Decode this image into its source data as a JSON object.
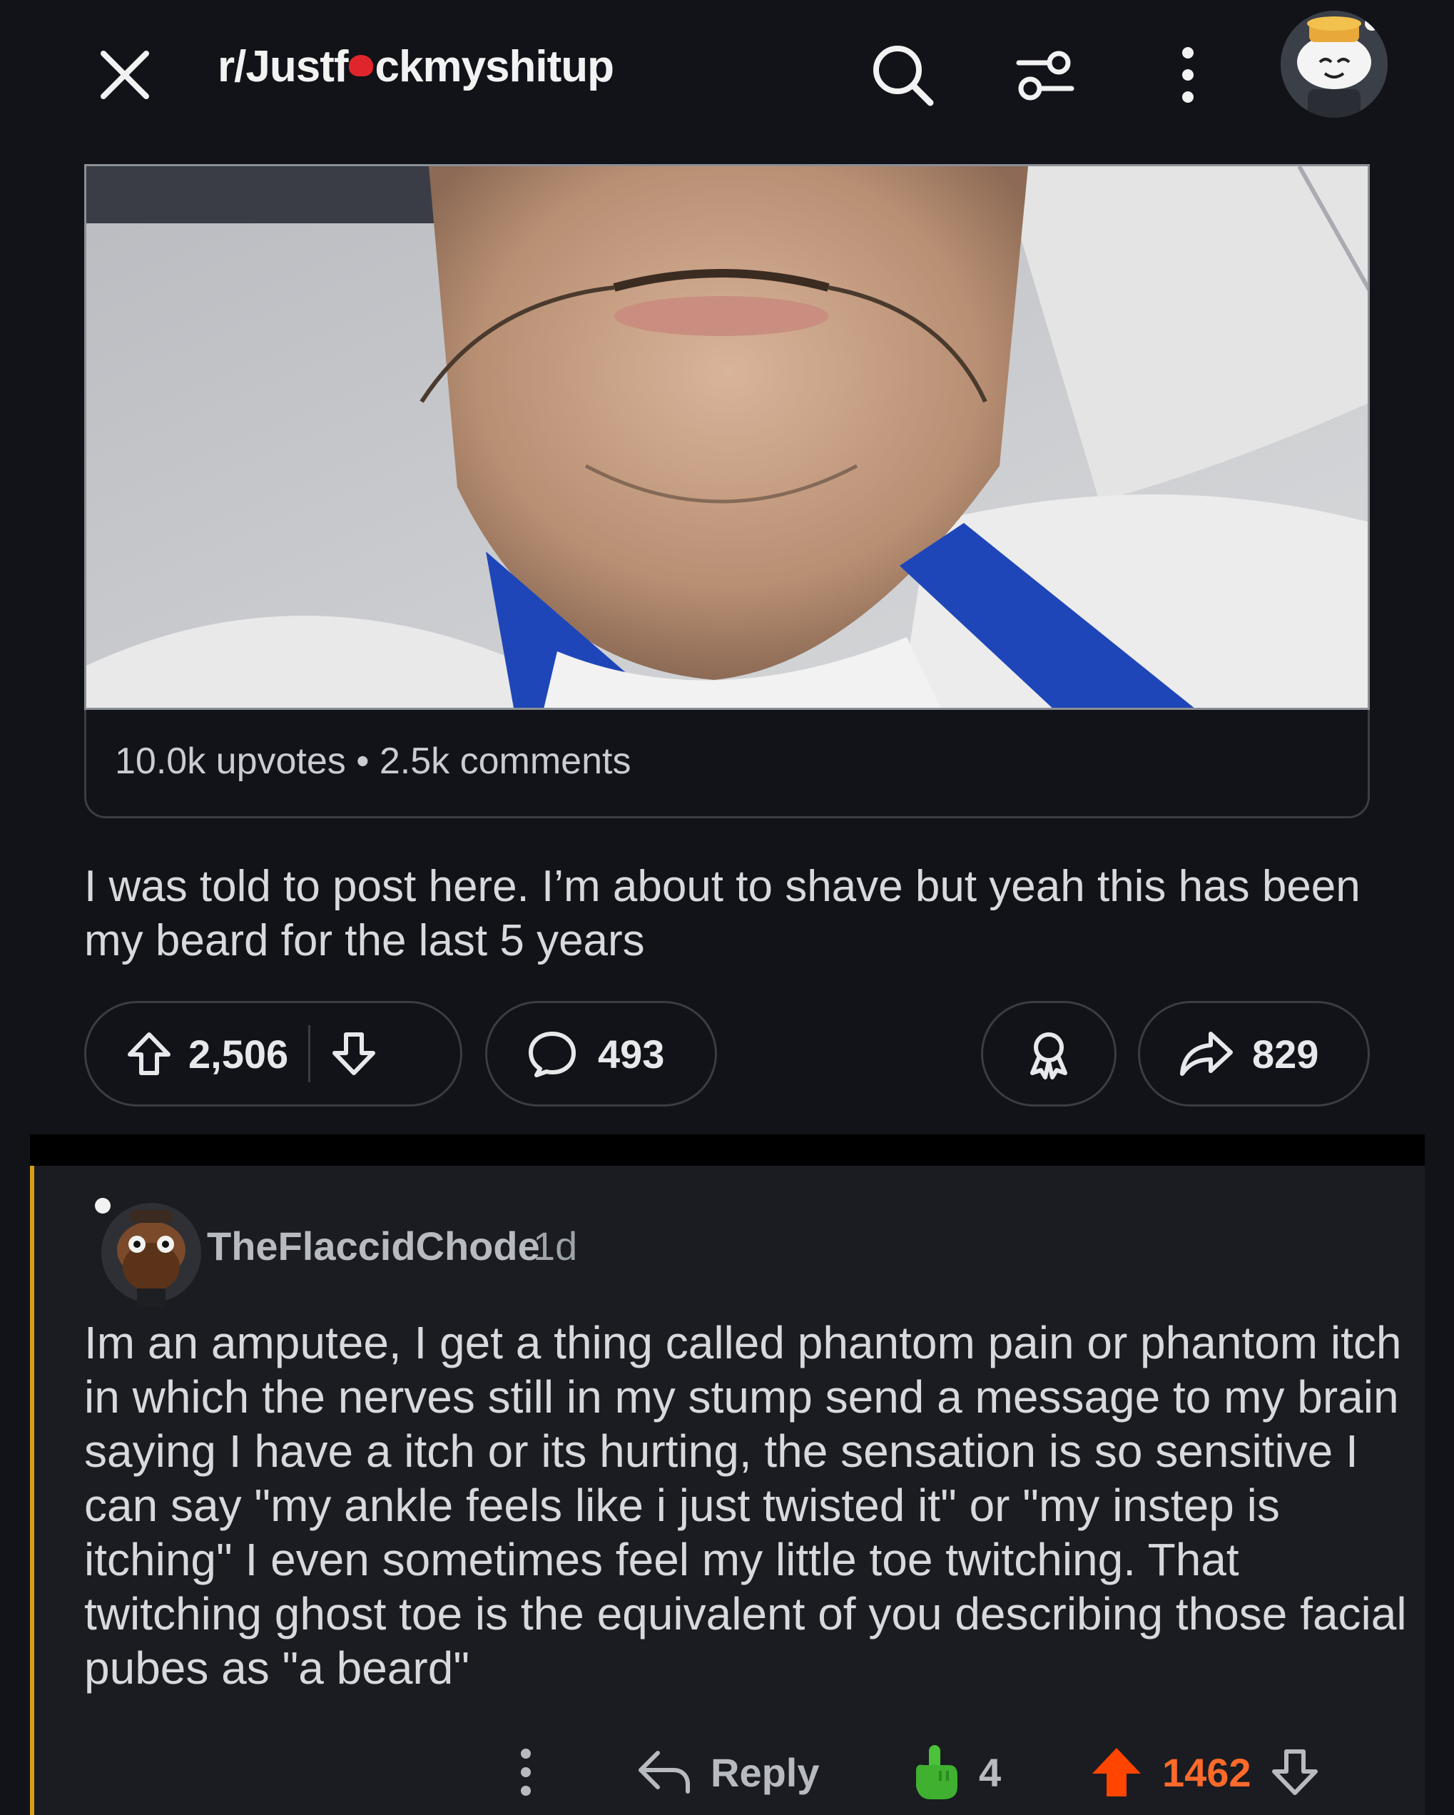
{
  "header": {
    "subreddit": "r/Justf",
    "subreddit_rest": "ckmyshitup",
    "icons": [
      "close-icon",
      "search-icon",
      "filter-icon",
      "more-icon"
    ]
  },
  "post": {
    "image_alt": "selfie",
    "stats": "10.0k upvotes • 2.5k comments",
    "body": "I was told to post here. I’m about to shave but yeah this has been my beard for the last 5 years",
    "upvotes": "2,506",
    "comments": "493",
    "shares": "829"
  },
  "comment": {
    "username": "TheFlaccidChode",
    "age": "1d",
    "body": "Im an amputee, I get a thing called phantom pain or phantom itch in which the nerves still in my stump send a message to my brain saying I have a itch or its hurting, the sensation is so sensitive I can say \"my ankle feels like i just twisted it\" or \"my instep is itching\" I even sometimes feel my little toe twitching. That twitching ghost toe is the equivalent of you describing those facial pubes as \"a beard\"",
    "reply_label": "Reply",
    "award_count": "4",
    "votes": "1462"
  },
  "colors": {
    "background": "#111318",
    "comment_bg": "#1a1c21",
    "upvote_active": "#ff4500",
    "thread_bar": "#d4a017"
  }
}
